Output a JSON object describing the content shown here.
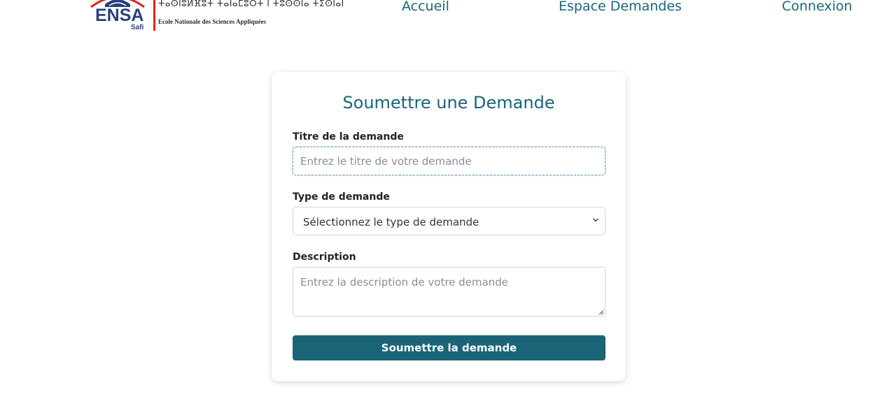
{
  "header": {
    "logo": {
      "name": "ENSA",
      "city": "Safi",
      "tifinagh": "ⵜⴰⵙⵏⵓⵍⴼⵓⵜ ⵜⴰⵏⴰⵎⵓⵔⵜ ⵏ ⵜⵓⵙⵙⵏⴰ ⵜⵉⵙⵏⴰⵏ",
      "school_name": "Ecole Nationale des Sciences Appliquées"
    },
    "nav": {
      "home": "Accueil",
      "requests": "Espace Demandes",
      "login": "Connexion"
    }
  },
  "form": {
    "title": "Soumettre une Demande",
    "title_field": {
      "label": "Titre de la demande",
      "placeholder": "Entrez le titre de votre demande",
      "value": ""
    },
    "type_field": {
      "label": "Type de demande",
      "selected": "Sélectionnez le type de demande"
    },
    "description_field": {
      "label": "Description",
      "placeholder": "Entrez la description de votre demande",
      "value": ""
    },
    "submit_label": "Soumettre la demande"
  },
  "colors": {
    "accent": "#1b6478",
    "logo_blue": "#27407e",
    "logo_red": "#e2231a"
  }
}
